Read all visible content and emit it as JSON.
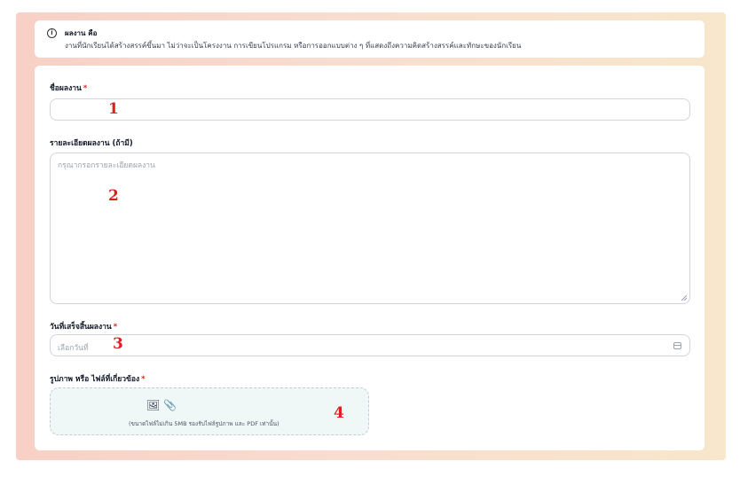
{
  "info": {
    "icon": "info-icon",
    "title": "ผลงาน คือ",
    "text": "งานที่นักเรียนได้สร้างสรรค์ขึ้นมา ไม่ว่าจะเป็นโครงงาน การเขียนโปรแกรม หรือการออกแบบต่าง ๆ ที่แสดงถึงความคิดสร้างสรรค์และทักษะของนักเรียน"
  },
  "form": {
    "name_label": "ชื่อผลงาน",
    "name_value": "",
    "detail_label": "รายละเอียดผลงาน (ถ้ามี)",
    "detail_placeholder": "กรุณากรอกรายละเอียดผลงาน",
    "date_label": "วันที่เสร็จสิ้นผลงาน",
    "date_placeholder": "เลือกวันที่",
    "file_label": "รูปภาพ หรือ ไฟล์ที่เกี่ยวข้อง",
    "file_hint": "(ขนาดไฟล์ไม่เกิน 5MB รองรับไฟล์รูปภาพ และ PDF เท่านั้น)",
    "required_mark": "*"
  },
  "annotations": [
    "1",
    "2",
    "3",
    "4"
  ],
  "colors": {
    "required": "#dc2626",
    "annotation": "#dc1f1f",
    "upload_bg": "#f0f7f7"
  }
}
